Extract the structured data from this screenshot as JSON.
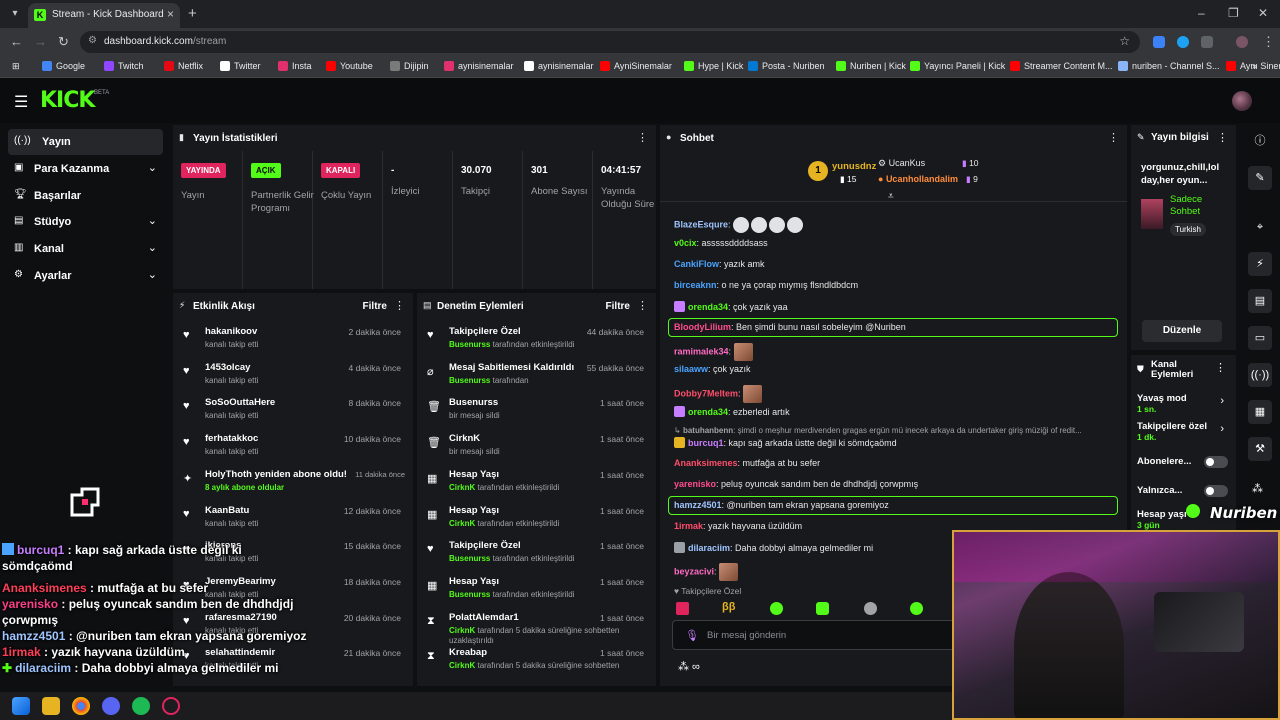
{
  "browser": {
    "tab_title": "Stream - Kick Dashboard",
    "url_host": "dashboard.kick.com",
    "url_path": "/stream",
    "bookmarks": [
      "Google",
      "Twitch",
      "Netflix",
      "Twitter",
      "Insta",
      "Youtube",
      "Dijipin",
      "aynisinemalar",
      "aynisinemalar",
      "AyniSinemalar",
      "Hype | Kick",
      "Posta - Nuriben",
      "Nuriben | Kick",
      "Yayıncı Paneli | Kick",
      "Streamer Content M...",
      "nuriben - Channel S...",
      "Aynı Sinemalar - Ça..."
    ]
  },
  "brand": {
    "logo": "KICK",
    "beta": "BETA"
  },
  "sidebar": {
    "items": [
      {
        "label": "Yayın",
        "icon": "broadcast-icon"
      },
      {
        "label": "Para Kazanma",
        "icon": "money-icon"
      },
      {
        "label": "Başarılar",
        "icon": "trophy-icon"
      },
      {
        "label": "Stüdyo",
        "icon": "studio-icon"
      },
      {
        "label": "Kanal",
        "icon": "channel-icon"
      },
      {
        "label": "Ayarlar",
        "icon": "gear-icon"
      }
    ]
  },
  "stats": {
    "title": "Yayın İstatistikleri",
    "items": [
      {
        "value": "YAYINDA",
        "label": "Yayın"
      },
      {
        "value": "AÇIK",
        "label": "Partnerlik Gelir Programı"
      },
      {
        "value": "KAPALI",
        "label": "Çoklu Yayın"
      },
      {
        "value": "-",
        "label": "İzleyici"
      },
      {
        "value": "30.070",
        "label": "Takipçi"
      },
      {
        "value": "301",
        "label": "Abone Sayısı"
      },
      {
        "value": "04:41:57",
        "label": "Yayında Olduğu Süre"
      }
    ]
  },
  "activity": {
    "title": "Etkinlik Akışı",
    "filter": "Filtre",
    "items": [
      {
        "title": "hakanikoov",
        "sub": "kanalı takip etti",
        "time": "2 dakika önce"
      },
      {
        "title": "1453olcay",
        "sub": "kanalı takip etti",
        "time": "4 dakika önce"
      },
      {
        "title": "SoSoOuttaHere",
        "sub": "kanalı takip etti",
        "time": "8 dakika önce"
      },
      {
        "title": "ferhatakkoc",
        "sub": "kanalı takip etti",
        "time": "10 dakika önce"
      },
      {
        "title": "HolyThoth yeniden abone oldu!",
        "sub_green": "8 aylık abone oldular",
        "time": "11 dakika önce"
      },
      {
        "title": "KaanBatu",
        "sub": "kanalı takip etti",
        "time": "12 dakika önce"
      },
      {
        "title": "ikierons",
        "sub": "kanalı takip etti",
        "time": "15 dakika önce"
      },
      {
        "title": "JeremyBearimy",
        "sub": "kanalı takip etti",
        "time": "18 dakika önce"
      },
      {
        "title": "rafaresma27190",
        "sub": "kanalı takip etti",
        "time": "20 dakika önce"
      },
      {
        "title": "selahattindemir",
        "sub": "kanalı takip etti",
        "time": "21 dakika önce"
      }
    ]
  },
  "moderation": {
    "title": "Denetim Eylemleri",
    "filter": "Filtre",
    "items": [
      {
        "title": "Takipçilere Özel",
        "user": "Busenurss",
        "sub": "tarafından etkinleştirildi",
        "time": "44 dakika önce"
      },
      {
        "title": "Mesaj Sabitlemesi Kaldırıldı",
        "user": "Busenurss",
        "sub": "tarafından",
        "time": "55 dakika önce"
      },
      {
        "title": "Busenurss",
        "user": "",
        "sub": "bir mesajı sildi",
        "time": "1 saat önce"
      },
      {
        "title": "CirknK",
        "user": "",
        "sub": "bir mesajı sildi",
        "time": "1 saat önce"
      },
      {
        "title": "Hesap Yaşı",
        "user": "CirknK",
        "sub": "tarafından etkinleştirildi",
        "time": "1 saat önce"
      },
      {
        "title": "Hesap Yaşı",
        "user": "CirknK",
        "sub": "tarafından etkinleştirildi",
        "time": "1 saat önce"
      },
      {
        "title": "Takipçilere Özel",
        "user": "Busenurss",
        "sub": "tarafından etkinleştirildi",
        "time": "1 saat önce"
      },
      {
        "title": "Hesap Yaşı",
        "user": "Busenurss",
        "sub": "tarafından etkinleştirildi",
        "time": "1 saat önce"
      },
      {
        "title": "PolattAlemdar1",
        "user": "CirknK",
        "sub": "tarafından 5 dakika süreliğine sohbetten uzaklaştırıldı",
        "time": "1 saat önce"
      },
      {
        "title": "Kreabap",
        "user": "CirknK",
        "sub": "tarafından 5 dakika süreliğine sohbetten",
        "time": "1 saat önce"
      }
    ]
  },
  "chat": {
    "title": "Sohbet",
    "top_gifters": [
      {
        "name": "yunusdnz",
        "count": "15"
      },
      {
        "name": "UcanKus",
        "count": "10"
      },
      {
        "name": "Ucanhollandalim",
        "count": "9"
      }
    ],
    "messages": [
      {
        "user": "BlazeEsqure",
        "text": "",
        "color": "#9ec5ff"
      },
      {
        "user": "v0cix",
        "text": "asssssddddsass",
        "color": "#53fc18"
      },
      {
        "user": "CankiFlow",
        "text": "yazık amk",
        "color": "#4aa3ff"
      },
      {
        "user": "birceaknn",
        "text": "o ne ya çorap mıymış flsndldbdcm",
        "color": "#4aa3ff"
      },
      {
        "user": "orenda34",
        "text": "çok yazık yaa",
        "color": "#53fc18"
      },
      {
        "user": "BloodyLilium",
        "text": "Ben şimdi bunu nasıl sobeleyim @Nuriben",
        "color": "#ff4d8b"
      },
      {
        "user": "ramimalek34",
        "text": "",
        "color": "#ff6bc4"
      },
      {
        "user": "silaaww",
        "text": "çok yazık",
        "color": "#4aa3ff"
      },
      {
        "user": "Dobby7Meltem",
        "text": "",
        "color": "#ff4d6b"
      },
      {
        "user": "orenda34",
        "text": "ezberledi artık",
        "color": "#53fc18"
      },
      {
        "user": "batuhanbenn",
        "text": "şimdi o meşhur merdivenden gragas ergün mü inecek arkaya da undertaker giriş müziği of redit...",
        "color": "#a0a3a8"
      },
      {
        "user": "burcuq1",
        "text": "kapı sağ arkada üstte değil ki sömdçaömd",
        "color": "#c77dff"
      },
      {
        "user": "Ananksimenes",
        "text": "mutfağa at bu sefer",
        "color": "#ff4d6b"
      },
      {
        "user": "yarenisko",
        "text": "peluş oyuncak sandım ben de dhdhdjdj çorwpmış",
        "color": "#ff4d8b"
      },
      {
        "user": "hamzz4501",
        "text": "@nuriben tam ekran yapsana goremiyoz",
        "color": "#9ec5ff"
      },
      {
        "user": "1irmak",
        "text": "yazık hayvana üzüldüm",
        "color": "#ff4d6b"
      },
      {
        "user": "dilaraciim",
        "text": "Daha dobbyi almaya gelmediler mi",
        "color": "#9ec5ff"
      },
      {
        "user": "beyzacivi",
        "text": "",
        "color": "#ff6bc4"
      }
    ],
    "mode": "Takipçilere Özel",
    "input_placeholder": "Bir mesaj gönderin"
  },
  "stream_info": {
    "title": "Yayın bilgisi",
    "desc": "yorgunuz,chill,lol day,her oyun...",
    "mode": "Sadece Sohbet",
    "language": "Turkish",
    "edit": "Düzenle"
  },
  "channel_actions": {
    "title": "Kanal Eylemleri",
    "items": [
      {
        "label": "Yavaş mod",
        "value": "1 sn."
      },
      {
        "label": "Takipçilere özel",
        "value": "1 dk."
      },
      {
        "label": "Abonelere...",
        "value": ""
      },
      {
        "label": "Yalnızca...",
        "value": ""
      },
      {
        "label": "Hesap yaşı",
        "value": "3 gün"
      }
    ]
  },
  "overlay": {
    "watermark": "Nuriben",
    "chat": [
      {
        "user": "burcuq1",
        "text": " : kapı sağ arkada üstte değil ki",
        "cont": "sömdçaömd",
        "color": "#c77dff"
      },
      {
        "user": "Ananksimenes",
        "text": " : mutfağa at bu sefer",
        "color": "#ff3f5a"
      },
      {
        "user": "yarenisko",
        "text": " : peluş oyuncak sandım ben de dhdhdjdj",
        "cont": "çorwpmış",
        "color": "#ff3f8b"
      },
      {
        "user": "hamzz4501",
        "text": " : @nuriben tam ekran yapsana goremiyoz",
        "color": "#9ec5ff"
      },
      {
        "user": "1irmak",
        "text": " : yazık hayvana üzüldüm",
        "color": "#ff3f5a"
      },
      {
        "user": "dilaraciim",
        "text": " : Daha dobbyi almaya gelmediler mi",
        "color": "#9ec5ff"
      }
    ]
  },
  "colors": {
    "accent": "#53fc18",
    "live": "#e0245e",
    "panel": "#18191c"
  }
}
